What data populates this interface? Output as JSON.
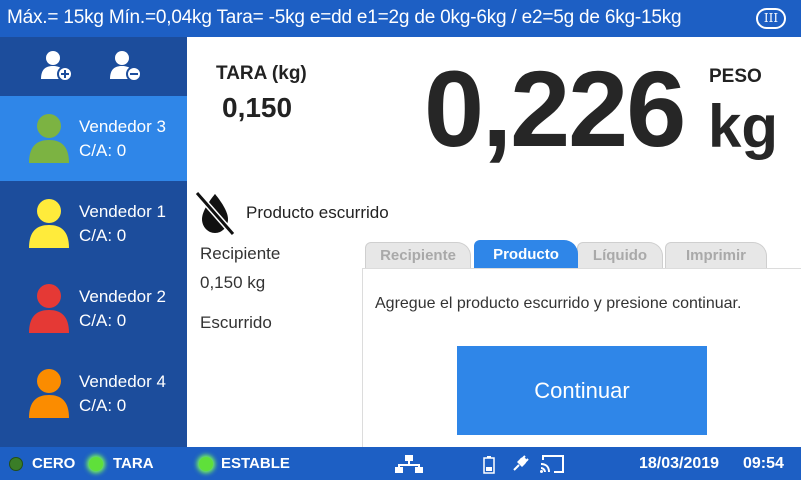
{
  "topbar": {
    "specs": "Máx.= 15kg  Mín.=0,04kg  Tara= -5kg  e=dd  e1=2g de 0kg-6kg / e2=5g de 6kg-15kg",
    "class_badge": "III"
  },
  "sidebar": {
    "sellers": [
      {
        "name": "Vendedor 3",
        "ca": "C/A: 0",
        "color": "#7cb342",
        "active": true
      },
      {
        "name": "Vendedor 1",
        "ca": "C/A: 0",
        "color": "#ffeb3b",
        "active": false
      },
      {
        "name": "Vendedor 2",
        "ca": "C/A: 0",
        "color": "#e53935",
        "active": false
      },
      {
        "name": "Vendedor 4",
        "ca": "C/A: 0",
        "color": "#fb8c00",
        "active": false
      }
    ]
  },
  "tara": {
    "label": "TARA (kg)",
    "value": "0,150"
  },
  "peso": {
    "label": "PESO",
    "value": "0,226",
    "unit": "kg"
  },
  "product": {
    "status": "Producto escurrido"
  },
  "info": {
    "recipiente_label": "Recipiente",
    "recipiente_value": "0,150 kg",
    "escurrido_label": "Escurrido"
  },
  "tabs": [
    {
      "label": "Recipiente",
      "active": false
    },
    {
      "label": "Producto",
      "active": true
    },
    {
      "label": "Líquido",
      "active": false
    },
    {
      "label": "Imprimir",
      "active": false
    }
  ],
  "panel": {
    "message": "Agregue el producto escurrido y presione continuar.",
    "button": "Continuar"
  },
  "statusbar": {
    "indicators": [
      {
        "label": "CERO",
        "on": false
      },
      {
        "label": "TARA",
        "on": true
      },
      {
        "label": "ESTABLE",
        "on": true
      }
    ],
    "date": "18/03/2019",
    "time": "09:54"
  },
  "colors": {
    "bar_blue": "#1d5fc4",
    "sidebar_blue": "#1c4d9c",
    "accent_blue": "#2f86e8",
    "led_green": "#5fe03a"
  }
}
